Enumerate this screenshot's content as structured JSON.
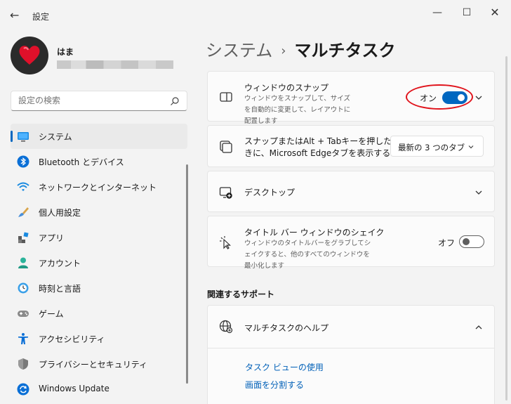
{
  "window": {
    "back_glyph": "←",
    "title": "設定",
    "min_glyph": "—",
    "max_glyph": "☐",
    "close_glyph": "✕"
  },
  "profile": {
    "name": "はま"
  },
  "search": {
    "placeholder": "設定の検索"
  },
  "sidebar": {
    "items": [
      {
        "label": "システム",
        "icon": "display-icon",
        "active": true
      },
      {
        "label": "Bluetooth とデバイス",
        "icon": "bluetooth-icon"
      },
      {
        "label": "ネットワークとインターネット",
        "icon": "wifi-icon"
      },
      {
        "label": "個人用設定",
        "icon": "paint-brush-icon"
      },
      {
        "label": "アプリ",
        "icon": "apps-icon"
      },
      {
        "label": "アカウント",
        "icon": "person-icon"
      },
      {
        "label": "時刻と言語",
        "icon": "globe-clock-icon"
      },
      {
        "label": "ゲーム",
        "icon": "gamepad-icon"
      },
      {
        "label": "アクセシビリティ",
        "icon": "accessibility-icon"
      },
      {
        "label": "プライバシーとセキュリティ",
        "icon": "shield-icon"
      },
      {
        "label": "Windows Update",
        "icon": "update-icon"
      }
    ]
  },
  "breadcrumb": {
    "parent": "システム",
    "separator": "›",
    "current": "マルチタスク"
  },
  "settings": {
    "snap": {
      "title": "ウィンドウのスナップ",
      "desc": "ウィンドウをスナップして、サイズを自動的に変更して、レイアウトに配置します",
      "toggle_label": "オン",
      "toggle_state": "on"
    },
    "alt_tab": {
      "title_line1": "スナップまたはAlt + Tabキーを押したと",
      "title_line2": "きに、Microsoft Edgeタブを表示する",
      "dropdown_value": "最新の 3 つのタブ"
    },
    "desktops": {
      "title": "デスクトップ"
    },
    "shake": {
      "title": "タイトル バー ウィンドウのシェイク",
      "desc": "ウィンドウのタイトルバーをグラブしてシェイクすると、他のすべてのウィンドウを最小化します",
      "toggle_label": "オフ",
      "toggle_state": "off"
    }
  },
  "support": {
    "section_title": "関連するサポート",
    "help_title": "マルチタスクのヘルプ",
    "links": [
      "タスク ビューの使用",
      "画面を分割する"
    ]
  },
  "colors": {
    "accent": "#0067c0",
    "callout": "#e0131b",
    "link": "#0060b8"
  }
}
